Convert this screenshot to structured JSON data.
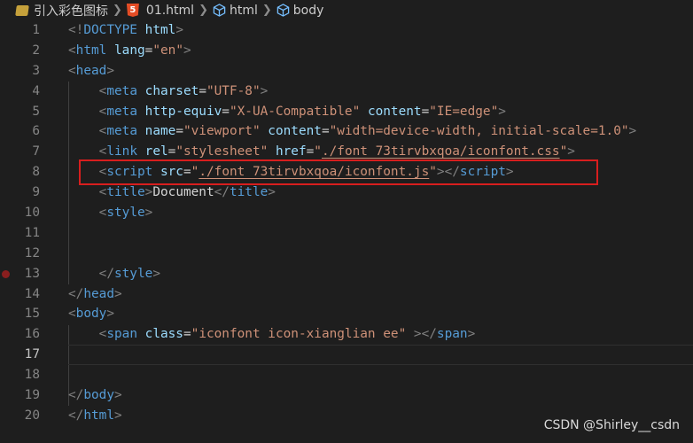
{
  "breadcrumb": {
    "folder": "引入彩色图标",
    "file": "01.html",
    "html5_badge": "5",
    "element1": "html",
    "element2": "body"
  },
  "lines": [
    {
      "num": "1",
      "tokens": [
        [
          "punc",
          "<!"
        ],
        [
          "doctype",
          "DOCTYPE"
        ],
        [
          "text",
          " "
        ],
        [
          "attr",
          "html"
        ],
        [
          "punc",
          ">"
        ]
      ]
    },
    {
      "num": "2",
      "tokens": [
        [
          "punc",
          "<"
        ],
        [
          "tag",
          "html"
        ],
        [
          "text",
          " "
        ],
        [
          "attr",
          "lang"
        ],
        [
          "text",
          "="
        ],
        [
          "str",
          "\"en\""
        ],
        [
          "punc",
          ">"
        ]
      ]
    },
    {
      "num": "3",
      "tokens": [
        [
          "punc",
          "<"
        ],
        [
          "tag",
          "head"
        ],
        [
          "punc",
          ">"
        ]
      ]
    },
    {
      "num": "4",
      "tokens": [
        [
          "text",
          "    "
        ],
        [
          "punc",
          "<"
        ],
        [
          "tag",
          "meta"
        ],
        [
          "text",
          " "
        ],
        [
          "attr",
          "charset"
        ],
        [
          "text",
          "="
        ],
        [
          "str",
          "\"UTF-8\""
        ],
        [
          "punc",
          ">"
        ]
      ]
    },
    {
      "num": "5",
      "tokens": [
        [
          "text",
          "    "
        ],
        [
          "punc",
          "<"
        ],
        [
          "tag",
          "meta"
        ],
        [
          "text",
          " "
        ],
        [
          "attr",
          "http-equiv"
        ],
        [
          "text",
          "="
        ],
        [
          "str",
          "\"X-UA-Compatible\""
        ],
        [
          "text",
          " "
        ],
        [
          "attr",
          "content"
        ],
        [
          "text",
          "="
        ],
        [
          "str",
          "\"IE=edge\""
        ],
        [
          "punc",
          ">"
        ]
      ]
    },
    {
      "num": "6",
      "tokens": [
        [
          "text",
          "    "
        ],
        [
          "punc",
          "<"
        ],
        [
          "tag",
          "meta"
        ],
        [
          "text",
          " "
        ],
        [
          "attr",
          "name"
        ],
        [
          "text",
          "="
        ],
        [
          "str",
          "\"viewport\""
        ],
        [
          "text",
          " "
        ],
        [
          "attr",
          "content"
        ],
        [
          "text",
          "="
        ],
        [
          "str",
          "\"width=device-width, initial-scale=1.0\""
        ],
        [
          "punc",
          ">"
        ]
      ]
    },
    {
      "num": "7",
      "tokens": [
        [
          "text",
          "    "
        ],
        [
          "punc",
          "<"
        ],
        [
          "tag",
          "link"
        ],
        [
          "text",
          " "
        ],
        [
          "attr",
          "rel"
        ],
        [
          "text",
          "="
        ],
        [
          "str",
          "\"stylesheet\""
        ],
        [
          "text",
          " "
        ],
        [
          "attr",
          "href"
        ],
        [
          "text",
          "="
        ],
        [
          "str",
          "\""
        ],
        [
          "str_u",
          "./font_73tirvbxqoa/iconfont.css"
        ],
        [
          "str",
          "\""
        ],
        [
          "punc",
          ">"
        ]
      ]
    },
    {
      "num": "8",
      "tokens": [
        [
          "text",
          "    "
        ],
        [
          "punc",
          "<"
        ],
        [
          "tag",
          "script"
        ],
        [
          "text",
          " "
        ],
        [
          "attr",
          "src"
        ],
        [
          "text",
          "="
        ],
        [
          "str",
          "\""
        ],
        [
          "str_u",
          "./font_73tirvbxqoa/iconfont.js"
        ],
        [
          "str",
          "\""
        ],
        [
          "punc",
          "></"
        ],
        [
          "tag",
          "script"
        ],
        [
          "punc",
          ">"
        ]
      ]
    },
    {
      "num": "9",
      "tokens": [
        [
          "text",
          "    "
        ],
        [
          "punc",
          "<"
        ],
        [
          "tag",
          "title"
        ],
        [
          "punc",
          ">"
        ],
        [
          "text",
          "Document"
        ],
        [
          "punc",
          "</"
        ],
        [
          "tag",
          "title"
        ],
        [
          "punc",
          ">"
        ]
      ]
    },
    {
      "num": "10",
      "tokens": [
        [
          "text",
          "    "
        ],
        [
          "punc",
          "<"
        ],
        [
          "tag",
          "style"
        ],
        [
          "punc",
          ">"
        ]
      ]
    },
    {
      "num": "11",
      "tokens": []
    },
    {
      "num": "12",
      "tokens": []
    },
    {
      "num": "13",
      "tokens": [
        [
          "text",
          "    "
        ],
        [
          "punc",
          "</"
        ],
        [
          "tag",
          "style"
        ],
        [
          "punc",
          ">"
        ]
      ]
    },
    {
      "num": "14",
      "tokens": [
        [
          "punc",
          "</"
        ],
        [
          "tag",
          "head"
        ],
        [
          "punc",
          ">"
        ]
      ]
    },
    {
      "num": "15",
      "tokens": [
        [
          "punc",
          "<"
        ],
        [
          "tag",
          "body"
        ],
        [
          "punc",
          ">"
        ]
      ]
    },
    {
      "num": "16",
      "tokens": [
        [
          "text",
          "    "
        ],
        [
          "punc",
          "<"
        ],
        [
          "tag",
          "span"
        ],
        [
          "text",
          " "
        ],
        [
          "attr",
          "class"
        ],
        [
          "text",
          "="
        ],
        [
          "str",
          "\"iconfont icon-xianglian ee\""
        ],
        [
          "text",
          " "
        ],
        [
          "punc",
          "></"
        ],
        [
          "tag",
          "span"
        ],
        [
          "punc",
          ">"
        ]
      ]
    },
    {
      "num": "17",
      "tokens": []
    },
    {
      "num": "18",
      "tokens": []
    },
    {
      "num": "19",
      "tokens": [
        [
          "punc",
          "</"
        ],
        [
          "tag",
          "body"
        ],
        [
          "punc",
          ">"
        ]
      ]
    },
    {
      "num": "20",
      "tokens": [
        [
          "punc",
          "</"
        ],
        [
          "tag",
          "html"
        ],
        [
          "punc",
          ">"
        ]
      ]
    }
  ],
  "active_line": "17",
  "breakpoint_line": "13",
  "watermark": "CSDN @Shirley__csdn",
  "colors": {
    "background": "#1e1e1e",
    "tag": "#569cd6",
    "attr": "#9cdcfe",
    "string": "#ce9178",
    "highlight_box": "#d81e1e"
  }
}
